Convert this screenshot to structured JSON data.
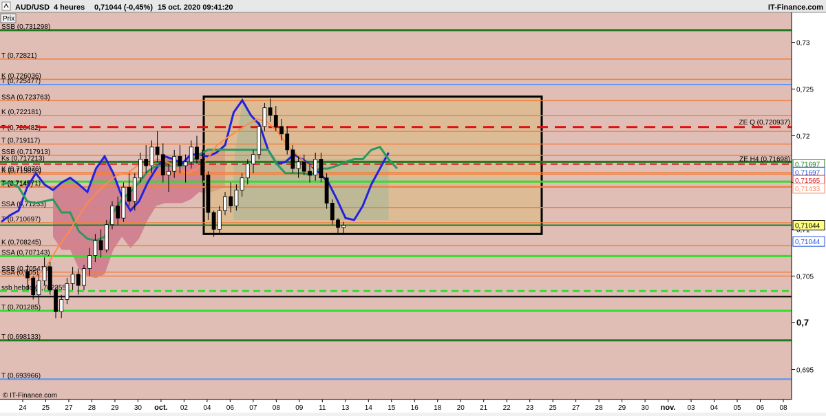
{
  "header": {
    "symbol": "AUD/USD",
    "timeframe": "4 heures",
    "quote": "0,71044 (-0,45%)",
    "datetime": "15 oct. 2020 09:41:20",
    "brand": "IT-Finance.com"
  },
  "prix_label": "Prix",
  "watermark": "© IT-Finance.com",
  "colors": {
    "background": "#e0bdb5",
    "cloud_bear": "#cc6b82",
    "cloud_bull": "#7fb3b8",
    "box_fill": "#d9b97a",
    "kijun_line": "#2a9a5a",
    "tenkan_line": "#2222dd",
    "chikou_line": "#ff8a4a",
    "ssa_line": "#3366dd",
    "ssb_line": "#dd2222",
    "price_tag": "#ffff80"
  },
  "y_axis": {
    "ticks": [
      "0,73",
      "0,725",
      "0,72",
      "0,715",
      "0,71",
      "0,705",
      "0,7",
      "0,695"
    ],
    "big_tick": "0,7"
  },
  "x_axis": {
    "labels": [
      "24",
      "25",
      "27",
      "28",
      "29",
      "30",
      "oct.",
      "02",
      "04",
      "06",
      "07",
      "08",
      "09",
      "11",
      "13",
      "14",
      "15",
      "16",
      "18",
      "20",
      "21",
      "22",
      "23",
      "25",
      "27",
      "28",
      "29",
      "30",
      "nov.",
      "03",
      "04",
      "05",
      "06",
      "08"
    ],
    "bold_labels": [
      "oct.",
      "nov."
    ]
  },
  "levels": [
    {
      "label": "SSB (0,731298)",
      "value": 0.731298,
      "color": "#1f7a1f",
      "width": 3,
      "dash": "none"
    },
    {
      "label": "T (0,72821)",
      "value": 0.72821,
      "color": "#f08040",
      "width": 1.5,
      "dash": "none"
    },
    {
      "label": "K (0,726036)",
      "value": 0.726036,
      "color": "#f08040",
      "width": 1.5,
      "dash": "none"
    },
    {
      "label": "T (0,725477)",
      "value": 0.725477,
      "color": "#6699ee",
      "width": 2,
      "dash": "none"
    },
    {
      "label": "SSA (0,723763)",
      "value": 0.723763,
      "color": "#f08040",
      "width": 1.5,
      "dash": "none"
    },
    {
      "label": "K (0,722181)",
      "value": 0.722181,
      "color": "#f08040",
      "width": 1.5,
      "dash": "none"
    },
    {
      "label": "T (0,720482)",
      "value": 0.720482,
      "color": "#f08040",
      "width": 1.5,
      "dash": "none"
    },
    {
      "label": "T (0,719117)",
      "value": 0.719117,
      "color": "#f08040",
      "width": 1.5,
      "dash": "none"
    },
    {
      "label": "SSB (0,717913)",
      "value": 0.717913,
      "color": "#f08040",
      "width": 1.5,
      "dash": "none"
    },
    {
      "label": "Ks (0,717213)",
      "value": 0.717213,
      "color": "#1f7a1f",
      "width": 3,
      "dash": "none"
    },
    {
      "label": "K (0,716076)",
      "value": 0.716076,
      "color": "#f08040",
      "width": 1.5,
      "dash": "none"
    },
    {
      "label": "K (0,715898)",
      "value": 0.715898,
      "color": "#f08040",
      "width": 1.5,
      "dash": "none"
    },
    {
      "label": "",
      "value": 0.7151,
      "color": "#33dd33",
      "width": 3,
      "dash": "none"
    },
    {
      "label": "T (0,714571)",
      "value": 0.714571,
      "color": "#f08040",
      "width": 1.5,
      "dash": "none"
    },
    {
      "label": "T (0,7145)",
      "value": 0.7145,
      "color": "#f08040",
      "width": 1.5,
      "dash": "none"
    },
    {
      "label": "SSA (0,71233)",
      "value": 0.71233,
      "color": "#f08040",
      "width": 1.5,
      "dash": "none"
    },
    {
      "label": "T (0,710697)",
      "value": 0.710697,
      "color": "#f08040",
      "width": 1.5,
      "dash": "none"
    },
    {
      "label": "",
      "value": 0.71044,
      "color": "#1f7a1f",
      "width": 2,
      "dash": "none"
    },
    {
      "label": "K (0,708245)",
      "value": 0.708245,
      "color": "#f08040",
      "width": 1.5,
      "dash": "none"
    },
    {
      "label": "SSA (0,707143)",
      "value": 0.707143,
      "color": "#33dd33",
      "width": 3,
      "dash": "none"
    },
    {
      "label": "SSB (0,705418)",
      "value": 0.705418,
      "color": "#f08040",
      "width": 1.5,
      "dash": "none"
    },
    {
      "label": "SSA (0,705)",
      "value": 0.705,
      "color": "#f08040",
      "width": 1.5,
      "dash": "none"
    },
    {
      "label": "ssb hebdo (0,702355)",
      "value": 0.7034,
      "color": "#33dd33",
      "width": 3,
      "dash": "10,6"
    },
    {
      "label": "",
      "value": 0.7028,
      "color": "#000000",
      "width": 2,
      "dash": "none"
    },
    {
      "label": "T (0,701285)",
      "value": 0.701285,
      "color": "#33dd33",
      "width": 3,
      "dash": "none"
    },
    {
      "label": "T (0,698133)",
      "value": 0.698133,
      "color": "#1f7a1f",
      "width": 3,
      "dash": "none"
    },
    {
      "label": "T (0,693966)",
      "value": 0.693966,
      "color": "#6699ee",
      "width": 2.5,
      "dash": "none"
    }
  ],
  "zones": [
    {
      "label": "ZE Q (0,720937)",
      "value": 0.720937,
      "color": "#dd1111",
      "width": 3,
      "dash": "16,10"
    },
    {
      "label": "ZE H4 (0,71698)",
      "value": 0.71698,
      "color": "#dd1111",
      "width": 2,
      "dash": "10,6"
    }
  ],
  "price_tags": [
    {
      "text": "0,71697",
      "value": 0.71697,
      "color": "#1f7a1f",
      "bg": "#ffffff"
    },
    {
      "text": "0,71697",
      "value": 0.71612,
      "color": "#2255dd",
      "bg": "#ffffff"
    },
    {
      "text": "0,71565",
      "value": 0.71526,
      "color": "#dd2222",
      "bg": "#ffffff"
    },
    {
      "text": "0,71433",
      "value": 0.71438,
      "color": "#ff8a60",
      "bg": "#ffffff"
    },
    {
      "text": "0,71044",
      "value": 0.71044,
      "color": "#000000",
      "bg": "#ffff80"
    },
    {
      "text": "0,71044",
      "value": 0.7087,
      "color": "#2255dd",
      "bg": "#ffffff"
    }
  ],
  "chart_data": {
    "type": "candlestick",
    "title": "AUD/USD 4 heures",
    "ylim": [
      0.6918,
      0.7332
    ],
    "box": {
      "high": 0.7242,
      "low": 0.7095
    },
    "candles": [
      [
        0.7055,
        0.7062,
        0.7035,
        0.7048
      ],
      [
        0.7048,
        0.705,
        0.7025,
        0.703
      ],
      [
        0.703,
        0.7052,
        0.702,
        0.7045
      ],
      [
        0.7045,
        0.707,
        0.704,
        0.706
      ],
      [
        0.706,
        0.7065,
        0.703,
        0.7035
      ],
      [
        0.7035,
        0.7038,
        0.7005,
        0.7012
      ],
      [
        0.7012,
        0.703,
        0.7005,
        0.7025
      ],
      [
        0.7025,
        0.7048,
        0.702,
        0.7042
      ],
      [
        0.7042,
        0.706,
        0.7035,
        0.7052
      ],
      [
        0.7052,
        0.7058,
        0.703,
        0.704
      ],
      [
        0.704,
        0.7062,
        0.7035,
        0.7058
      ],
      [
        0.7058,
        0.708,
        0.705,
        0.7072
      ],
      [
        0.7072,
        0.7095,
        0.7065,
        0.7088
      ],
      [
        0.7088,
        0.71,
        0.707,
        0.7078
      ],
      [
        0.7078,
        0.711,
        0.7075,
        0.7105
      ],
      [
        0.7105,
        0.713,
        0.71,
        0.7125
      ],
      [
        0.7125,
        0.7135,
        0.7105,
        0.7112
      ],
      [
        0.7112,
        0.715,
        0.7108,
        0.7145
      ],
      [
        0.7145,
        0.716,
        0.7125,
        0.713
      ],
      [
        0.713,
        0.716,
        0.712,
        0.7155
      ],
      [
        0.7155,
        0.7182,
        0.715,
        0.7175
      ],
      [
        0.7175,
        0.719,
        0.716,
        0.7168
      ],
      [
        0.7168,
        0.7195,
        0.716,
        0.7188
      ],
      [
        0.7188,
        0.7205,
        0.7172,
        0.718
      ],
      [
        0.718,
        0.7192,
        0.715,
        0.7158
      ],
      [
        0.7158,
        0.717,
        0.714,
        0.7162
      ],
      [
        0.7162,
        0.7185,
        0.7155,
        0.7178
      ],
      [
        0.7178,
        0.719,
        0.716,
        0.7168
      ],
      [
        0.7168,
        0.718,
        0.715,
        0.7172
      ],
      [
        0.7172,
        0.7195,
        0.7165,
        0.7188
      ],
      [
        0.7188,
        0.72,
        0.717,
        0.7175
      ],
      [
        0.7175,
        0.7185,
        0.715,
        0.7158
      ],
      [
        0.7158,
        0.7162,
        0.711,
        0.7118
      ],
      [
        0.7118,
        0.712,
        0.7092,
        0.71
      ],
      [
        0.71,
        0.7125,
        0.7095,
        0.712
      ],
      [
        0.712,
        0.714,
        0.7115,
        0.7135
      ],
      [
        0.7135,
        0.715,
        0.7118,
        0.7125
      ],
      [
        0.7125,
        0.7148,
        0.712,
        0.7142
      ],
      [
        0.7142,
        0.716,
        0.7135,
        0.7155
      ],
      [
        0.7155,
        0.7175,
        0.7148,
        0.717
      ],
      [
        0.717,
        0.7185,
        0.716,
        0.718
      ],
      [
        0.718,
        0.7215,
        0.7175,
        0.721
      ],
      [
        0.721,
        0.7235,
        0.7205,
        0.723
      ],
      [
        0.723,
        0.724,
        0.7215,
        0.7222
      ],
      [
        0.7222,
        0.7232,
        0.7205,
        0.721
      ],
      [
        0.721,
        0.7218,
        0.7195,
        0.7202
      ],
      [
        0.7202,
        0.721,
        0.718,
        0.7185
      ],
      [
        0.7185,
        0.719,
        0.716,
        0.7165
      ],
      [
        0.7165,
        0.7178,
        0.7155,
        0.7172
      ],
      [
        0.7172,
        0.718,
        0.7158,
        0.7162
      ],
      [
        0.7162,
        0.717,
        0.715,
        0.7158
      ],
      [
        0.7158,
        0.7182,
        0.7152,
        0.7175
      ],
      [
        0.7175,
        0.7182,
        0.715,
        0.7155
      ],
      [
        0.7155,
        0.716,
        0.7122,
        0.7128
      ],
      [
        0.7128,
        0.7132,
        0.7105,
        0.711
      ],
      [
        0.711,
        0.7112,
        0.7095,
        0.7102
      ],
      [
        0.7102,
        0.7108,
        0.7094,
        0.7104
      ]
    ],
    "series": [
      {
        "name": "Tenkan",
        "color": "#2222dd",
        "values": [
          0.7108,
          0.7115,
          0.712,
          0.7145,
          0.716,
          0.7148,
          0.7142,
          0.715,
          0.7155,
          0.7148,
          0.714,
          0.7165,
          0.7178,
          0.716,
          0.7135,
          0.712,
          0.713,
          0.715,
          0.7165,
          0.7178,
          0.7175,
          0.717,
          0.718,
          0.718,
          0.7178,
          0.7182,
          0.719,
          0.7225,
          0.7238,
          0.7222,
          0.7212,
          0.7185,
          0.717,
          0.7172,
          0.718,
          0.7175,
          0.7168,
          0.716,
          0.715,
          0.7132,
          0.7112,
          0.711,
          0.7125,
          0.7148,
          0.7165,
          0.7182
        ]
      },
      {
        "name": "Kijun",
        "color": "#2a9a5a",
        "values": [
          0.7148,
          0.715,
          0.7145,
          0.713,
          0.7128,
          0.713,
          0.7132,
          0.7118,
          0.7118,
          0.7098,
          0.709,
          0.7088,
          0.7092,
          0.7118,
          0.7132,
          0.714,
          0.715,
          0.7162,
          0.7168,
          0.7168,
          0.7168,
          0.7168,
          0.7172,
          0.718,
          0.7185,
          0.7185,
          0.7185,
          0.7185,
          0.7185,
          0.7185,
          0.7185,
          0.7185,
          0.717,
          0.716,
          0.716,
          0.716,
          0.7158,
          0.7165,
          0.7165,
          0.7168,
          0.7172,
          0.7175,
          0.7175,
          0.7185,
          0.7188,
          0.7175,
          0.7165
        ]
      },
      {
        "name": "Chikou",
        "color": "#ff8a4a",
        "values": [
          0.7045,
          0.705,
          0.7062,
          0.708,
          0.7095,
          0.7112,
          0.7128,
          0.714,
          0.715,
          0.7158,
          0.716,
          0.7168,
          0.717,
          0.7175,
          0.7172,
          0.7165,
          0.716,
          0.7165,
          0.7175,
          0.719,
          0.7198,
          0.7205,
          0.7212,
          0.7218,
          0.7215,
          0.7205,
          0.719,
          0.718,
          0.717,
          0.7165
        ]
      }
    ]
  }
}
